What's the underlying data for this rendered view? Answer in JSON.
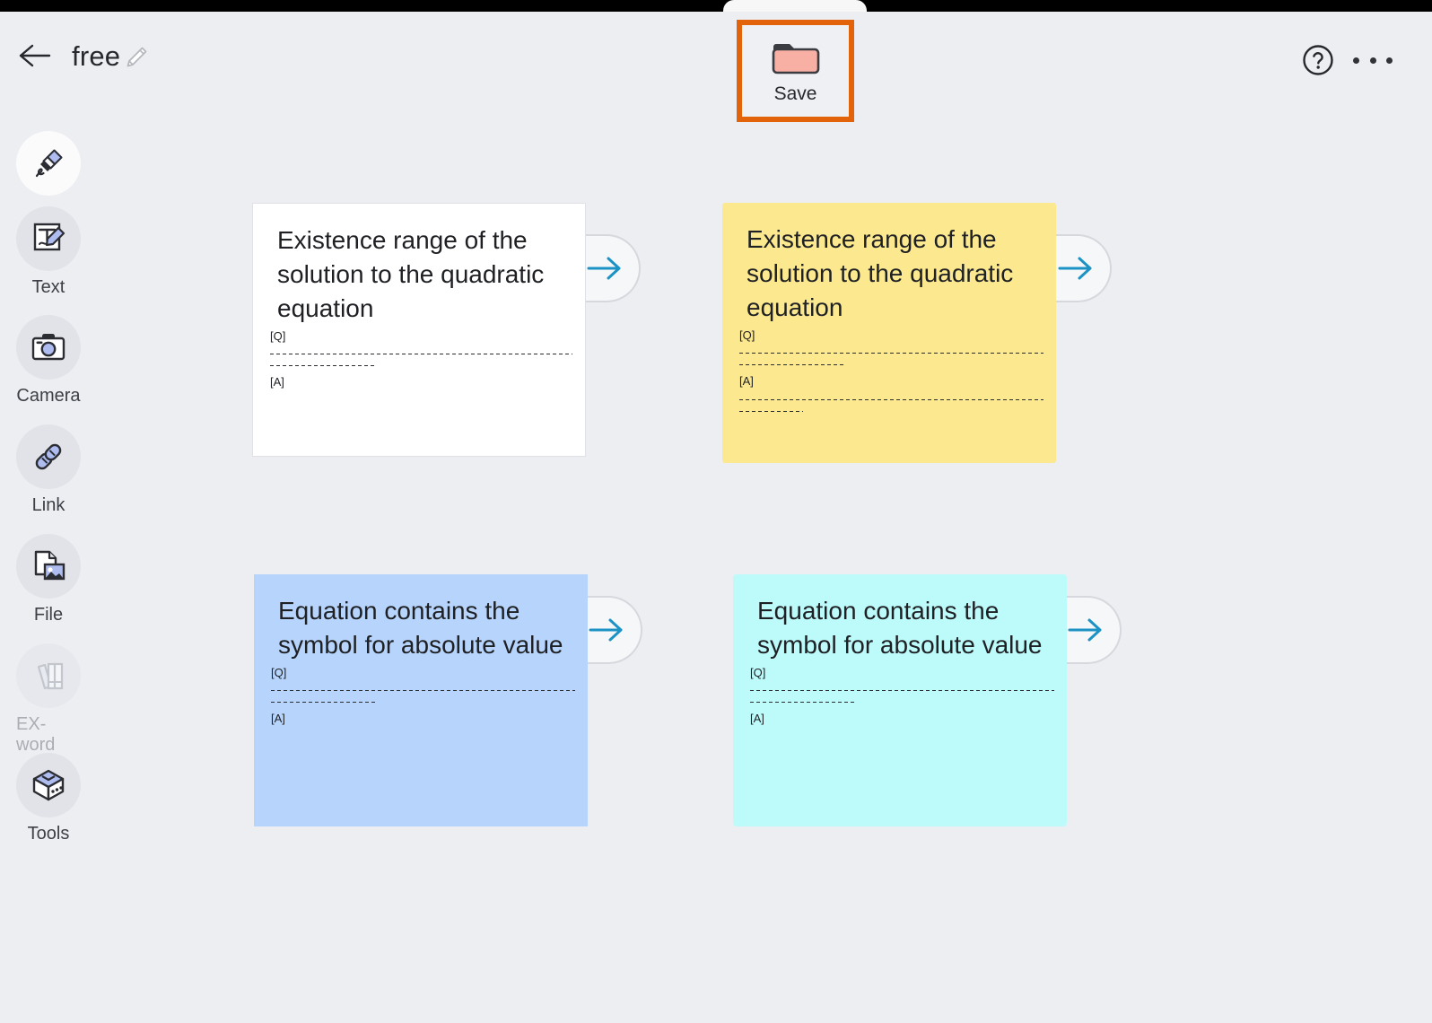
{
  "window": {
    "title_bar_color": "#000000",
    "surface_color": "#eceef2"
  },
  "header": {
    "back_label": "Back",
    "doc_title": "free",
    "edit_icon": "pencil-icon",
    "help_icon": "help-circle-icon",
    "more_icon": "more-horizontal-icon"
  },
  "toolbar": {
    "save_label": "Save",
    "save_icon": "folder-icon",
    "highlight_color": "#e2630a",
    "folder_color": "#f9b0a4"
  },
  "sidebar": {
    "items": [
      {
        "label": "",
        "icon": "marker-pen-icon",
        "name": "pen",
        "selected": true,
        "disabled": false
      },
      {
        "label": "Text",
        "icon": "text-edit-icon",
        "name": "text",
        "selected": false,
        "disabled": false
      },
      {
        "label": "Camera",
        "icon": "camera-icon",
        "name": "camera",
        "selected": false,
        "disabled": false
      },
      {
        "label": "Link",
        "icon": "link-chain-icon",
        "name": "link",
        "selected": false,
        "disabled": false
      },
      {
        "label": "File",
        "icon": "file-image-icon",
        "name": "file",
        "selected": false,
        "disabled": false
      },
      {
        "label": "EX-word",
        "icon": "books-icon",
        "name": "ex-word",
        "selected": false,
        "disabled": true
      },
      {
        "label": "Tools",
        "icon": "toolbox-cube-icon",
        "name": "tools",
        "selected": false,
        "disabled": false
      }
    ]
  },
  "canvas": {
    "cards": [
      {
        "title": "Existence range of the\nsolution to the quadratic\nequation",
        "question_tag": "[Q]",
        "answer_tag": "[A]",
        "color": "#ffffff",
        "has_answer_lines": false,
        "arrow_icon": "arrow-right-icon"
      },
      {
        "title": "Existence range of the\nsolution to the quadratic\nequation",
        "question_tag": "[Q]",
        "answer_tag": "[A]",
        "color": "#fbe88f",
        "has_answer_lines": true,
        "arrow_icon": "arrow-right-icon"
      },
      {
        "title": "Equation contains the\nsymbol for absolute value",
        "question_tag": "[Q]",
        "answer_tag": "[A]",
        "color": "#b7d5fc",
        "has_answer_lines": false,
        "arrow_icon": "arrow-right-icon"
      },
      {
        "title": "Equation contains the\nsymbol for absolute value",
        "question_tag": "[Q]",
        "answer_tag": "[A]",
        "color": "#bdfbfb",
        "has_answer_lines": false,
        "arrow_icon": "arrow-right-icon"
      }
    ]
  }
}
